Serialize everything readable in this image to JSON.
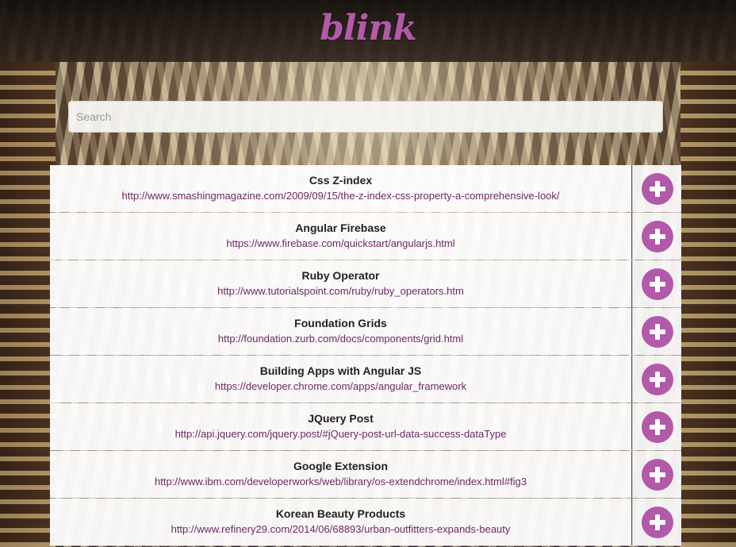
{
  "header": {
    "logo_text": "blink"
  },
  "search": {
    "placeholder": "Search",
    "value": ""
  },
  "links": [
    {
      "title": "Css Z-index",
      "url": "http://www.smashingmagazine.com/2009/09/15/the-z-index-css-property-a-comprehensive-look/"
    },
    {
      "title": "Angular Firebase",
      "url": "https://www.firebase.com/quickstart/angularjs.html"
    },
    {
      "title": "Ruby Operator",
      "url": "http://www.tutorialspoint.com/ruby/ruby_operators.htm"
    },
    {
      "title": "Foundation Grids",
      "url": "http://foundation.zurb.com/docs/components/grid.html"
    },
    {
      "title": "Building Apps with Angular JS",
      "url": "https://developer.chrome.com/apps/angular_framework"
    },
    {
      "title": "JQuery Post",
      "url": "http://api.jquery.com/jquery.post/#jQuery-post-url-data-success-dataType"
    },
    {
      "title": "Google Extension",
      "url": "http://www.ibm.com/developerworks/web/library/os-extendchrome/index.html#fig3"
    },
    {
      "title": "Korean Beauty Products",
      "url": "http://www.refinery29.com/2014/06/68893/urban-outfitters-expands-beauty"
    }
  ],
  "icons": {
    "add": "plus-circle-icon"
  },
  "colors": {
    "brand": "#b25aa8",
    "url_text": "#6b2a66"
  }
}
